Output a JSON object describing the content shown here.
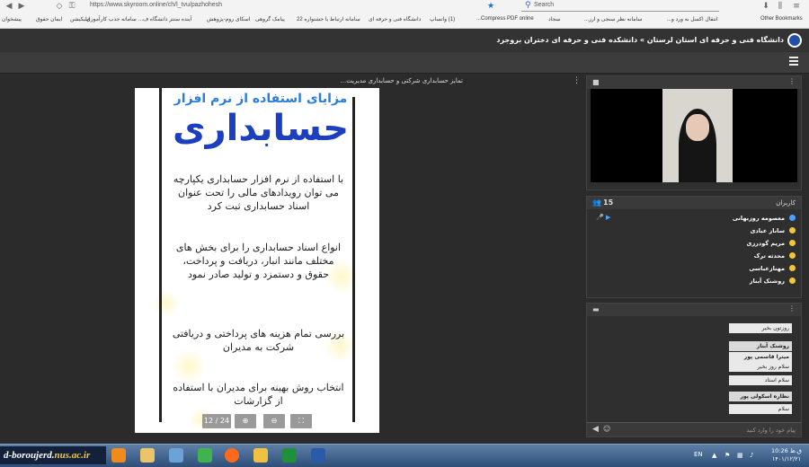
{
  "browser": {
    "url": "https://www.skyroom.online/ch/l_tvu/pazhohesh",
    "search_placeholder": "Search",
    "bookmarks": [
      "Other Bookmarks",
      "انتقال اکسل به ورد و...",
      "سامانه نظر سنجی و ارز...",
      "سجاد",
      "Compress PDF online...",
      "(1) واتساپ",
      "دانشگاه فنی و حرفه ای",
      "سامانه ارتباط با جشنواره 22",
      "پیامک گروهی",
      "اسکای روم-پژوهش",
      "آینده سنتز دانشگاه ف...",
      "سامانه جذب کارآموزی",
      "اپلیکیشن",
      "ایمان حقوق",
      "پیشخوان"
    ]
  },
  "app": {
    "title": "دانشگاه فنی و حرفه ای استان لرستان » دانشکده فنی و حرفه ای دختران بروجرد"
  },
  "viewer": {
    "title": "تمایز حسابداری شرکتی و حسابداری مدیریت...",
    "slide": {
      "title": "مزایای استفاده از نرم افزار",
      "big": "حسابداری",
      "p1": "با استفاده از نرم افزار حسابداری یکپارچه می توان رویدادهای مالی را تحت عنوان اسناد حسابداری ثبت کرد",
      "p2": "انواع اسناد حسابداری را برای بخش های مختلف مانند انبار، دریافت و پرداخت، حقوق و دستمزد و تولید صادر نمود",
      "p3": "بررسی تمام هزینه های پرداختی و دریافتی شرکت به مدیران",
      "p4": "انتخاب روش بهینه برای مدیران با استفاده از گزارشات"
    },
    "page_indicator": "12 / 24"
  },
  "users": {
    "title": "کاربران",
    "count": "15",
    "list": [
      {
        "name": "معصومه روزبهانی",
        "color": "#4aa3ff"
      },
      {
        "name": "ساناز عبادی",
        "color": "#f3c53c"
      },
      {
        "name": "مریم گودرزی",
        "color": "#f3c53c"
      },
      {
        "name": "محدثه ترک",
        "color": "#f3c53c"
      },
      {
        "name": "مهنازعباسی",
        "color": "#f3c53c"
      },
      {
        "name": "روشنک آبناز",
        "color": "#f3c53c"
      }
    ]
  },
  "chat": {
    "messages": [
      {
        "text": "روزتون بخیر",
        "bold": false
      },
      {
        "text": "روشنک آبناز",
        "bold": true
      },
      {
        "text": "میترا قاسمی پور",
        "bold": true
      },
      {
        "text": "سلام روز بخیر",
        "bold": false
      },
      {
        "text": "سلام استاد",
        "bold": false
      },
      {
        "text": "نظاره اسکولی پور",
        "bold": true
      },
      {
        "text": "سلام",
        "bold": false
      }
    ],
    "input_placeholder": "پیام خود را وارد کنید"
  },
  "taskbar": {
    "start_text_1": "d-boroujerd.",
    "start_text_2": "nus.ac.ir",
    "lang": "EN",
    "time": "10:26 ق.ظ",
    "date": "۱۴۰۱/۱۲/۲۱"
  },
  "colors": {
    "slide_title": "#2a7de0",
    "slide_big": "#1c3fbf",
    "app_bg": "#2b2b2b",
    "accent": "#4aa3ff"
  }
}
